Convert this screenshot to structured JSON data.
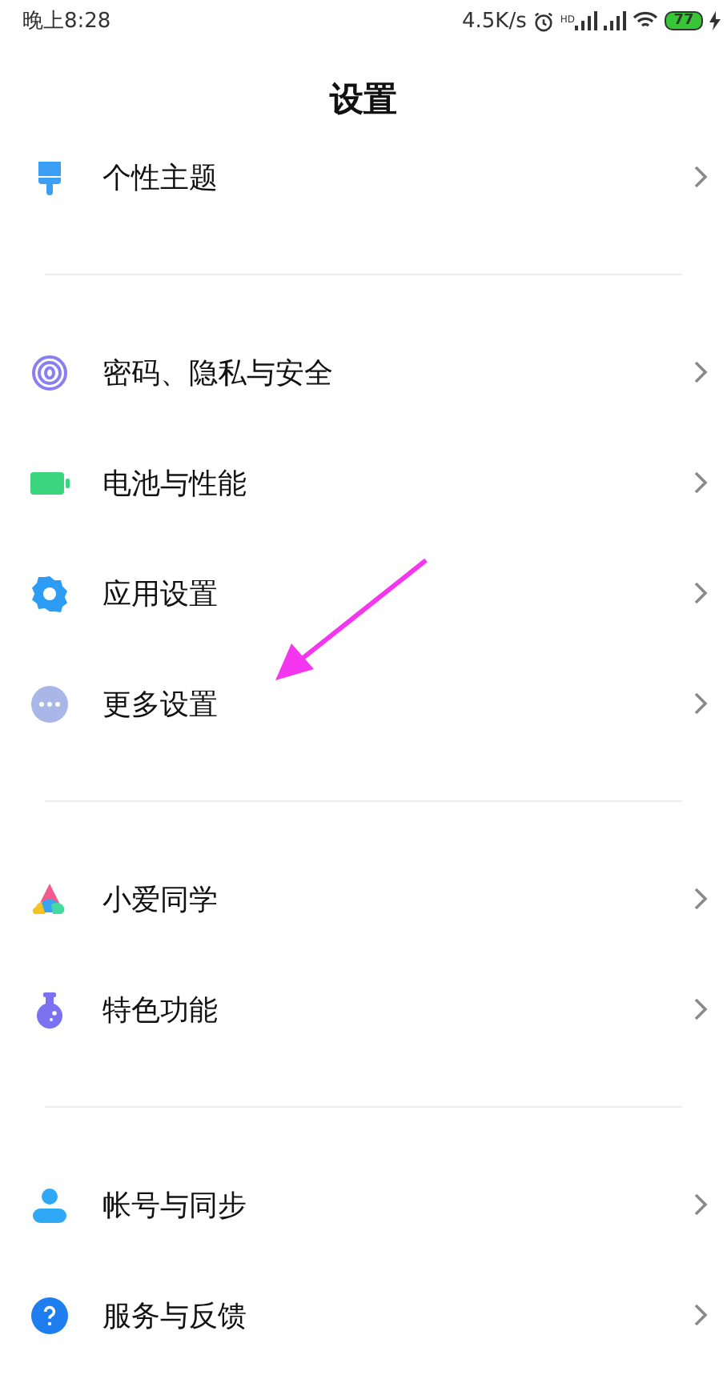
{
  "status_bar": {
    "time": "晚上8:28",
    "speed": "4.5K/s",
    "hd_label": "HD",
    "battery": "77",
    "charging": true
  },
  "title": "设置",
  "sections": [
    {
      "items": [
        {
          "kind": "brush",
          "label": "个性主题"
        }
      ]
    },
    {
      "items": [
        {
          "kind": "fingerprint",
          "label": "密码、隐私与安全"
        },
        {
          "kind": "battery",
          "label": "电池与性能"
        },
        {
          "kind": "gear",
          "label": "应用设置"
        },
        {
          "kind": "dots",
          "label": "更多设置"
        }
      ]
    },
    {
      "items": [
        {
          "kind": "assistant",
          "label": "小爱同学"
        },
        {
          "kind": "flask",
          "label": "特色功能"
        }
      ]
    },
    {
      "items": [
        {
          "kind": "person",
          "label": "帐号与同步"
        },
        {
          "kind": "help",
          "label": "服务与反馈"
        }
      ]
    }
  ],
  "annotation": {
    "kind": "arrow",
    "color": "#f437ef"
  }
}
